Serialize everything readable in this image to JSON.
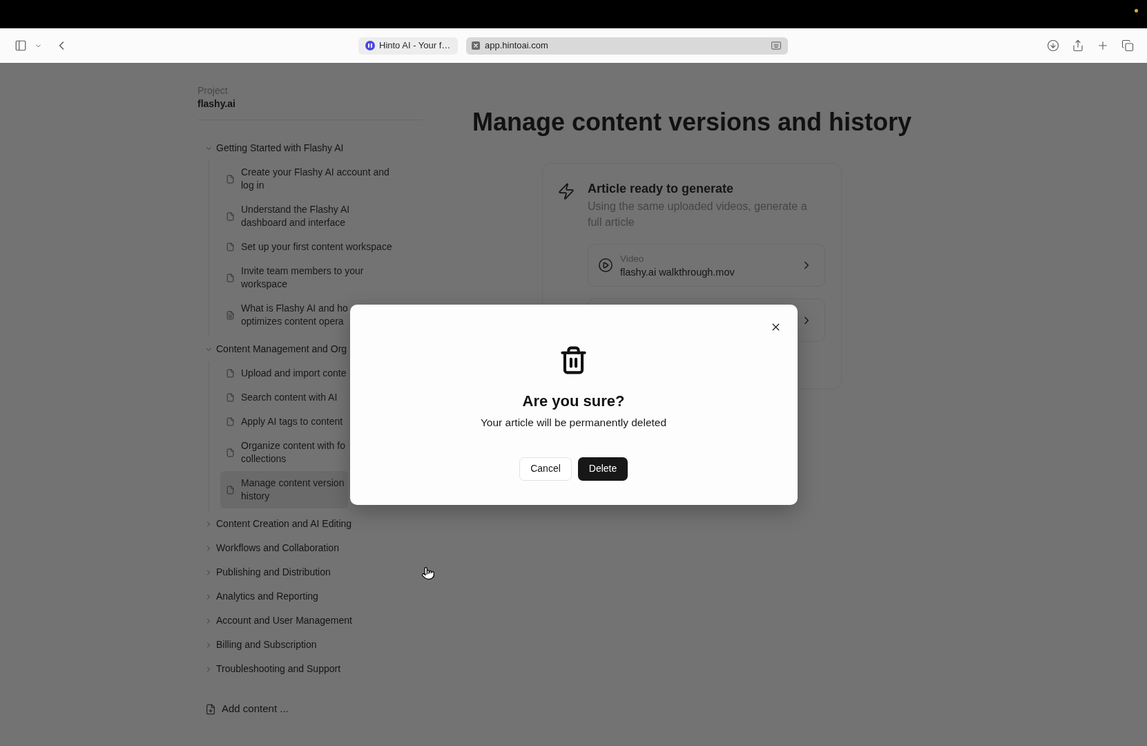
{
  "browser": {
    "tabs": [
      {
        "title": "Hinto AI - Your f…",
        "selected": false
      },
      {
        "title": "app.hintoai.com",
        "selected": true
      }
    ]
  },
  "sidebar": {
    "project_label": "Project",
    "project_name": "flashy.ai",
    "sections": [
      {
        "title": "Getting Started with Flashy AI",
        "expanded": true,
        "children": [
          {
            "title": "Create your Flashy AI account and log in",
            "kind": "blank",
            "selected": false
          },
          {
            "title": "Understand the Flashy AI dashboard and interface",
            "kind": "blank",
            "selected": false
          },
          {
            "title": "Set up your first content workspace",
            "kind": "blank",
            "selected": false
          },
          {
            "title": "Invite team members to your workspace",
            "kind": "blank",
            "selected": false
          },
          {
            "title": "What is Flashy AI and ho\noptimizes content opera",
            "kind": "lined",
            "selected": false
          }
        ]
      },
      {
        "title": "Content Management and Org",
        "expanded": true,
        "children": [
          {
            "title": "Upload and import conte",
            "kind": "blank",
            "selected": false
          },
          {
            "title": "Search content with AI",
            "kind": "blank",
            "selected": false
          },
          {
            "title": "Apply AI tags to content",
            "kind": "blank",
            "selected": false
          },
          {
            "title": "Organize content with fo\ncollections",
            "kind": "blank",
            "selected": false
          },
          {
            "title": "Manage content version\nhistory",
            "kind": "blank",
            "selected": true
          }
        ]
      },
      {
        "title": "Content Creation and AI Editing",
        "expanded": false
      },
      {
        "title": "Workflows and Collaboration",
        "expanded": false
      },
      {
        "title": "Publishing and Distribution",
        "expanded": false
      },
      {
        "title": "Analytics and Reporting",
        "expanded": false
      },
      {
        "title": "Account and User Management",
        "expanded": false
      },
      {
        "title": "Billing and Subscription",
        "expanded": false
      },
      {
        "title": "Troubleshooting and Support",
        "expanded": false
      }
    ],
    "add_content": "Add content ..."
  },
  "main": {
    "title": "Manage content versions and history",
    "card": {
      "title": "Article ready to generate",
      "description": "Using the same uploaded videos, generate a full article",
      "rows": [
        {
          "kind": "video",
          "label": "Video",
          "name": "flashy.ai walkthrough.mov"
        },
        {
          "kind": "covered"
        }
      ]
    }
  },
  "dialog": {
    "title": "Are you sure?",
    "message": "Your article will be permanently deleted",
    "buttons": [
      {
        "kind": "cancel",
        "label": "Cancel"
      },
      {
        "kind": "destructive",
        "label": "Delete"
      }
    ]
  }
}
